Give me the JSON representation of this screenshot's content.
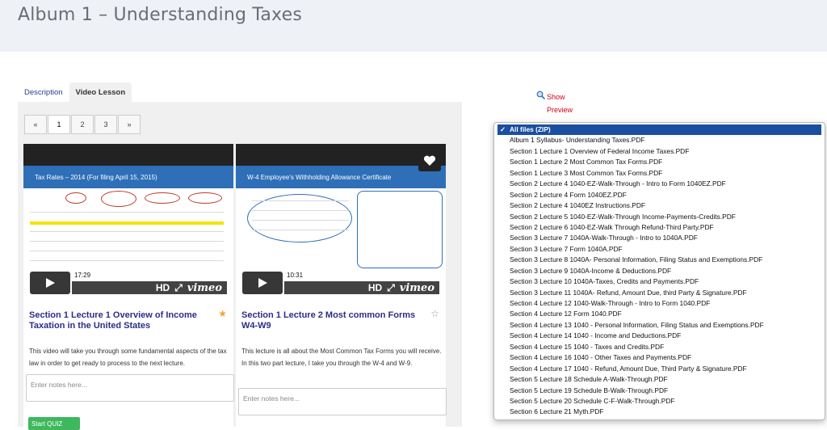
{
  "page": {
    "title": "Album 1 – Understanding Taxes"
  },
  "tabs": [
    {
      "label": "Description"
    },
    {
      "label": "Video Lesson"
    }
  ],
  "pagination": {
    "prev": "«",
    "pages": [
      "1",
      "2",
      "3"
    ],
    "next": "»",
    "current": "1"
  },
  "cards": [
    {
      "slide_title": "Tax Rates – 2014 (For filing April 15, 2015)",
      "duration": "17:29",
      "player_brand": "vimeo",
      "hd_label": "HD",
      "title": "Section 1 Lecture 1 Overview of Income Taxation in the United States",
      "favorited": true,
      "description": "This video will take you through some fundamental aspects of the tax law in order to get ready to process to the next lecture.",
      "notes_placeholder": "Enter notes here...",
      "quiz_label": "Start QUIZ"
    },
    {
      "slide_title": "W-4 Employee's Withholding Allowance Certificate",
      "duration": "10:31",
      "player_brand": "vimeo",
      "hd_label": "HD",
      "title": "Section 1 Lecture 2 Most common Forms W4-W9",
      "favorited": false,
      "description": "This lecture is all about the Most Common Tax Forms you will receive. In this two part lecture, I take you through the W-4 and W-9.",
      "notes_placeholder": "Enter notes here..."
    }
  ],
  "preview": {
    "show": "Show",
    "preview": "Preview"
  },
  "files": {
    "selected": "All files (ZIP)",
    "options": [
      "Album 1 Syllabus- Understanding Taxes.PDF",
      "Section 1 Lecture 1 Overview of Federal Income Taxes.PDF",
      "Section 1 Lecture 2 Most Common Tax Forms.PDF",
      "Section 1 Lecture 3 Most Common Tax Forms.PDF",
      "Section 2 Lecture 4 1040-EZ-Walk-Through - Intro to Form 1040EZ.PDF",
      "Section 2 Lecture 4 Form 1040EZ.PDF",
      "Section 2 Lecture 4 1040EZ Instructions.PDF",
      "Section 2 Lecture 5 1040-EZ-Walk-Through Income-Payments-Credits.PDF",
      "Section 2 Lecture 6 1040-EZ-Walk Through Refund-Third Party.PDF",
      "Section 3 Lecture 7 1040A-Walk-Through - Intro to 1040A.PDF",
      "Section 3 Lecture 7 Form 1040A.PDF",
      "Section 3 Lecture 8 1040A- Personal Information, Filing Status and Exemptions.PDF",
      "Section 3 Lecture 9 1040A-Income & Deductions.PDF",
      "Section 3 Lecture 10 1040A-Taxes, Credits and Payments.PDF",
      "Section 3 Lecture 11 1040A- Refund, Amount Due, third Party & Signature.PDF",
      "Section 4 Lecture 12 1040-Walk-Through - Intro to Form 1040.PDF",
      "Section 4 Lecture 12 Form 1040.PDF",
      "Section 4 Lecture 13 1040 - Personal Information, Filing Status and Exemptions.PDF",
      "Section 4 Lecture 14 1040 - Income and Deductions.PDF",
      "Section 4 Lecture 15 1040 - Taxes and Credits.PDF",
      "Section 4 Lecture 16 1040 - Other Taxes and Payments.PDF",
      "Section 4 Lecture 17 1040 - Refund, Amount Due, Third Party & Signature.PDF",
      "Section 5 Lecture 18 Schedule A-Walk-Through.PDF",
      "Section 5 Lecture 19 Schedule B-Walk-Through.PDF",
      "Section 5 Lecture 20 Schedule C-F-Walk-Through.PDF",
      "Section 6 Lecture 21 Myth.PDF"
    ]
  },
  "colors": {
    "link_purple": "#2b2d8a",
    "favorite_star": "#f5a623",
    "select_highlight": "#1a4fa0",
    "quiz_green": "#3db85c",
    "preview_red": "#d0021b"
  }
}
